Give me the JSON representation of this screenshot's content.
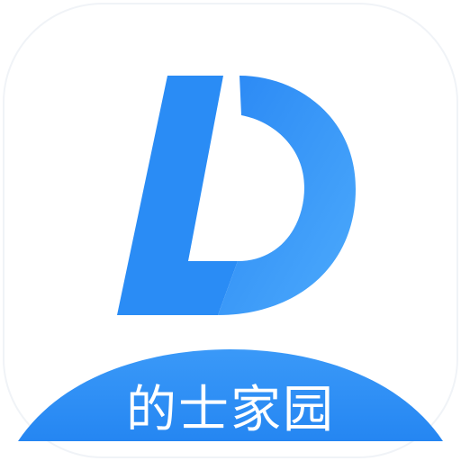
{
  "app": {
    "name": "的士家园",
    "logo": "letter-d-logo-icon"
  },
  "colors": {
    "background": "#ffffff",
    "brand_blue": "#2a8cf5",
    "brand_blue_light": "#47a7fb",
    "banner_blue": "#2f91f6",
    "text": "#ffffff"
  }
}
